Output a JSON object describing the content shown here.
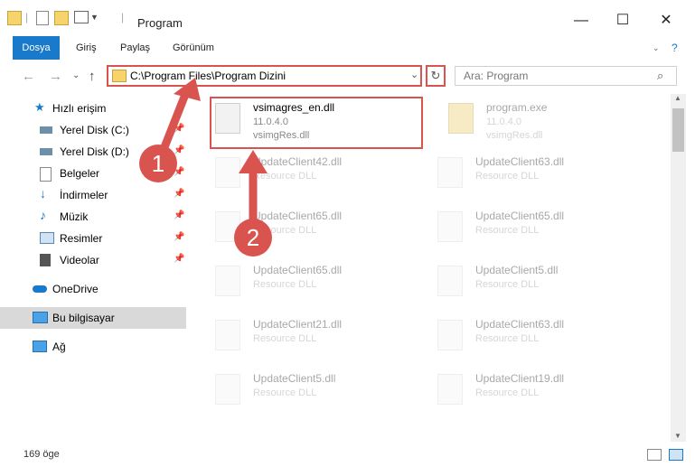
{
  "window": {
    "title": "Program"
  },
  "ribbon": {
    "tabs": [
      "Dosya",
      "Giriş",
      "Paylaş",
      "Görünüm"
    ]
  },
  "address": {
    "path": "C:\\Program Files\\Program Dizini"
  },
  "search": {
    "placeholder": "Ara: Program"
  },
  "sidebar": {
    "items": [
      {
        "label": "Hızlı erişim",
        "icon": "star-icon"
      },
      {
        "label": "Yerel Disk (C:)",
        "icon": "drive-icon"
      },
      {
        "label": "Yerel Disk (D:)",
        "icon": "drive-icon"
      },
      {
        "label": "Belgeler",
        "icon": "documents-icon"
      },
      {
        "label": "İndirmeler",
        "icon": "download-icon"
      },
      {
        "label": "Müzik",
        "icon": "music-icon"
      },
      {
        "label": "Resimler",
        "icon": "pictures-icon"
      },
      {
        "label": "Videolar",
        "icon": "video-icon"
      },
      {
        "label": "OneDrive",
        "icon": "cloud-icon"
      },
      {
        "label": "Bu bilgisayar",
        "icon": "computer-icon"
      },
      {
        "label": "Ağ",
        "icon": "network-icon"
      }
    ]
  },
  "files": [
    {
      "name": "vsimagres_en.dll",
      "line1": "11.0.4.0",
      "line2": "vsimgRes.dll"
    },
    {
      "name": "program.exe",
      "line1": "11.0.4.0",
      "line2": "vsimgRes.dll"
    },
    {
      "name": "UpdateClient42.dll",
      "line1": "Resource DLL"
    },
    {
      "name": "UpdateClient63.dll",
      "line1": "Resource DLL"
    },
    {
      "name": "UpdateClient65.dll",
      "line1": "Resource DLL"
    },
    {
      "name": "UpdateClient65.dll",
      "line1": "Resource DLL"
    },
    {
      "name": "UpdateClient65.dll",
      "line1": "Resource DLL"
    },
    {
      "name": "UpdateClient5.dll",
      "line1": "Resource DLL"
    },
    {
      "name": "UpdateClient21.dll",
      "line1": "Resource DLL"
    },
    {
      "name": "UpdateClient63.dll",
      "line1": "Resource DLL"
    },
    {
      "name": "UpdateClient5.dll",
      "line1": "Resource DLL"
    },
    {
      "name": "UpdateClient19.dll",
      "line1": "Resource DLL"
    }
  ],
  "status": {
    "item_count": "169 öge"
  },
  "annotations": {
    "badge1": "1",
    "badge2": "2"
  },
  "colors": {
    "accent": "#1979ca",
    "annotation": "#d9534f"
  }
}
